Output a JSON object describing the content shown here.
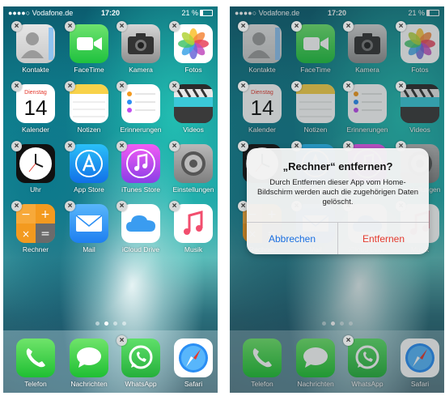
{
  "status": {
    "carrier": "●●●●○ Vodafone.de",
    "time": "17:20",
    "battery": "21 %"
  },
  "calendar": {
    "weekday": "Dienstag",
    "day": "14"
  },
  "apps": [
    {
      "label": "Kontakte",
      "icon": "contacts-icon",
      "color": "#d9d9d9"
    },
    {
      "label": "FaceTime",
      "icon": "facetime-icon",
      "color": "#2cc444"
    },
    {
      "label": "Kamera",
      "icon": "camera-icon",
      "color": "#9a9a9a"
    },
    {
      "label": "Fotos",
      "icon": "photos-icon",
      "color": "#ffffff"
    },
    {
      "label": "Kalender",
      "icon": "calendar-icon",
      "color": "#ffffff"
    },
    {
      "label": "Notizen",
      "icon": "notes-icon",
      "color": "#ffffff"
    },
    {
      "label": "Erinnerungen",
      "icon": "reminders-icon",
      "color": "#ffffff"
    },
    {
      "label": "Videos",
      "icon": "videos-icon",
      "color": "#2b2b2b"
    },
    {
      "label": "Uhr",
      "icon": "clock-icon",
      "color": "#111111"
    },
    {
      "label": "App Store",
      "icon": "app-store-icon",
      "color": "#1a8cf0"
    },
    {
      "label": "iTunes Store",
      "icon": "itunes-icon",
      "color": "#c04cf0"
    },
    {
      "label": "Einstellungen",
      "icon": "settings-icon",
      "color": "#8e8e8e"
    },
    {
      "label": "Rechner",
      "icon": "calculator-icon",
      "color": "#f39a1f"
    },
    {
      "label": "Mail",
      "icon": "mail-icon",
      "color": "#2a8ef4"
    },
    {
      "label": "iCloud Drive",
      "icon": "icloud-icon",
      "color": "#ffffff"
    },
    {
      "label": "Musik",
      "icon": "music-icon",
      "color": "#ffffff"
    }
  ],
  "dock": [
    {
      "label": "Telefon",
      "icon": "phone-icon"
    },
    {
      "label": "Nachrichten",
      "icon": "messages-icon"
    },
    {
      "label": "WhatsApp",
      "icon": "whatsapp-icon"
    },
    {
      "label": "Safari",
      "icon": "safari-icon"
    }
  ],
  "delete_glyph": "×",
  "alert": {
    "title": "„Rechner“ entfernen?",
    "message": "Durch Entfernen dieser App vom Home-Bildschirm werden auch die zugehörigen Daten gelöscht.",
    "cancel": "Abbrechen",
    "remove": "Entfernen",
    "cancel_color": "#1a6fe0",
    "remove_color": "#e43a2e"
  }
}
